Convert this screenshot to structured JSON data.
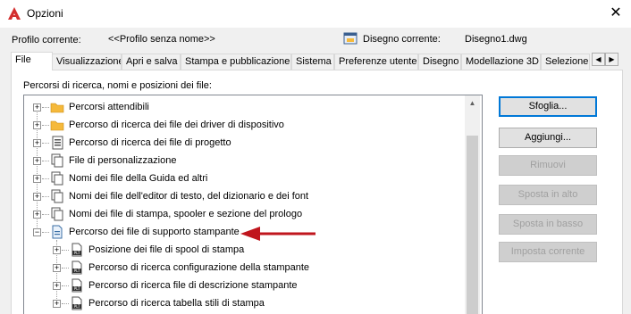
{
  "window": {
    "title": "Opzioni",
    "close_glyph": "✕"
  },
  "profile": {
    "label": "Profilo corrente:",
    "value": "<<Profilo senza nome>>"
  },
  "drawing": {
    "label": "Disegno corrente:",
    "value": "Disegno1.dwg"
  },
  "tabs": [
    {
      "label": "File",
      "active": true
    },
    {
      "label": "Visualizzazione"
    },
    {
      "label": "Apri e salva"
    },
    {
      "label": "Stampa e pubblicazione"
    },
    {
      "label": "Sistema"
    },
    {
      "label": "Preferenze utente"
    },
    {
      "label": "Disegno"
    },
    {
      "label": "Modellazione 3D"
    },
    {
      "label": "Selezione"
    }
  ],
  "tab_scroll": {
    "left": "◀",
    "right": "▶"
  },
  "section_label": "Percorsi di ricerca, nomi e posizioni dei file:",
  "tree": [
    {
      "label": "Percorsi attendibili",
      "icon": "folder-icon",
      "expander": "+"
    },
    {
      "label": "Percorso di ricerca dei file dei driver di dispositivo",
      "icon": "folder-icon",
      "expander": "+"
    },
    {
      "label": "Percorso di ricerca dei file di progetto",
      "icon": "project-file-icon",
      "expander": "+"
    },
    {
      "label": "File di personalizzazione",
      "icon": "documents-icon",
      "expander": "+"
    },
    {
      "label": "Nomi dei file della Guida ed altri",
      "icon": "documents-icon",
      "expander": "+"
    },
    {
      "label": "Nomi dei file dell'editor di testo, del dizionario e dei font",
      "icon": "documents-icon",
      "expander": "+"
    },
    {
      "label": "Nomi dei file di stampa, spooler e sezione del prologo",
      "icon": "documents-icon",
      "expander": "+"
    },
    {
      "label": "Percorso dei file di supporto stampante",
      "icon": "printer-file-icon",
      "expander": "−"
    },
    {
      "label": "Posizione dei file di spool di stampa",
      "icon": "plt-file-icon",
      "expander": "+"
    },
    {
      "label": "Percorso di ricerca configurazione della stampante",
      "icon": "plt-file-icon",
      "expander": "+"
    },
    {
      "label": "Percorso di ricerca file di descrizione stampante",
      "icon": "plt-file-icon",
      "expander": "+"
    },
    {
      "label": "Percorso di ricerca tabella stili di stampa",
      "icon": "plt-file-icon",
      "expander": "+"
    }
  ],
  "icon_text": {
    "plt": "PLT"
  },
  "scroll": {
    "up": "▲",
    "down": "▼"
  },
  "buttons": {
    "browse": "Sfoglia...",
    "add": "Aggiungi...",
    "remove": "Rimuovi",
    "move_up": "Sposta in alto",
    "move_down": "Sposta in basso",
    "set_current": "Imposta corrente"
  },
  "colors": {
    "accent": "#0078d7",
    "arrow": "#c0161d",
    "folder": "#f5b93b",
    "autocad_red": "#d32f2f"
  }
}
